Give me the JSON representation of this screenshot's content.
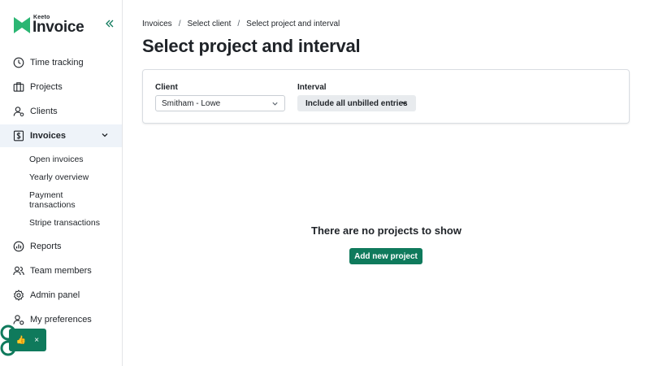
{
  "brand": {
    "small": "Keeto",
    "big": "Invoice",
    "accent": "#0f7a5c"
  },
  "sidebar": {
    "collapse_icon": "double-chevron-left-icon",
    "items": [
      {
        "label": "Time tracking",
        "icon": "clock-icon"
      },
      {
        "label": "Projects",
        "icon": "briefcase-icon"
      },
      {
        "label": "Clients",
        "icon": "user-icon"
      },
      {
        "label": "Invoices",
        "icon": "dollar-document-icon",
        "active": true,
        "expanded": true
      },
      {
        "label": "Reports",
        "icon": "chart-icon"
      },
      {
        "label": "Team members",
        "icon": "users-icon"
      },
      {
        "label": "Admin panel",
        "icon": "gear-icon"
      },
      {
        "label": "My preferences",
        "icon": "user-gear-icon"
      }
    ],
    "subitems": [
      {
        "label": "Open invoices"
      },
      {
        "label": "Yearly overview"
      },
      {
        "label": "Payment transactions"
      },
      {
        "label": "Stripe transactions"
      }
    ]
  },
  "feedback": {
    "thumb": "👍",
    "close": "×"
  },
  "breadcrumb": [
    "Invoices",
    "Select client",
    "Select project and interval"
  ],
  "breadcrumb_sep": "/",
  "page_title": "Select project and interval",
  "form": {
    "client_label": "Client",
    "client_value": "Smitham - Lowe",
    "interval_label": "Interval",
    "interval_value": "Include all unbilled entries"
  },
  "empty_state": {
    "message": "There are no projects to show",
    "button": "Add new project"
  }
}
